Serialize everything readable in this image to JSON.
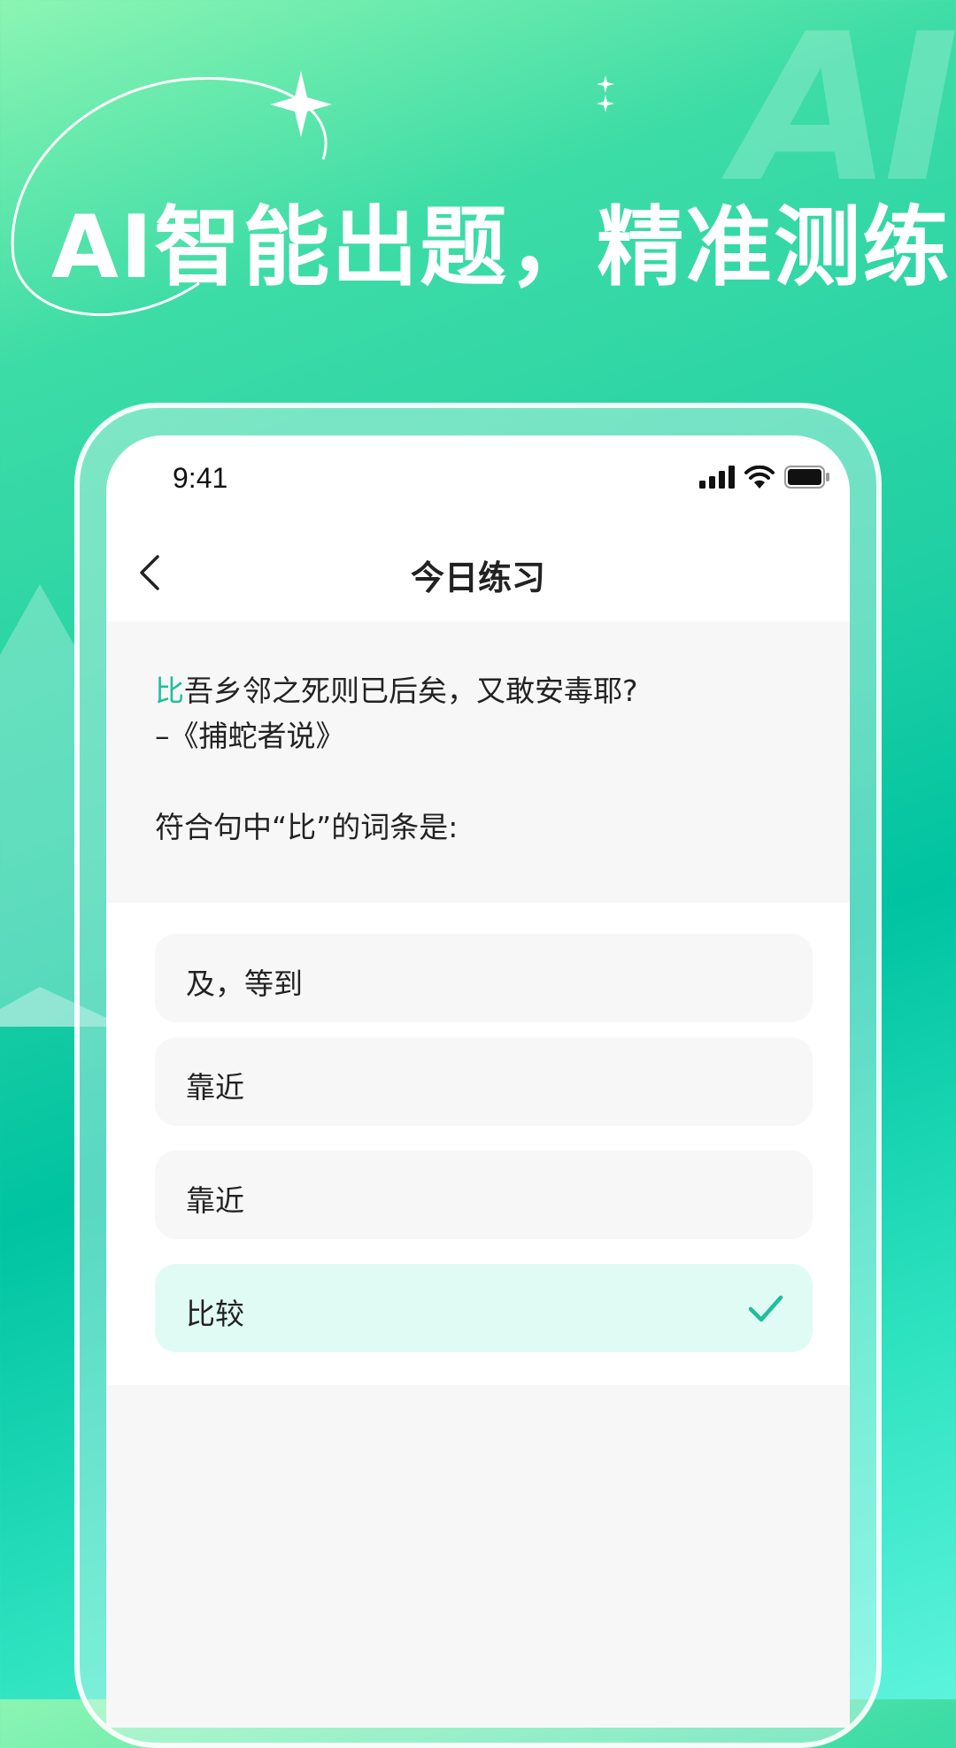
{
  "banner": {
    "headline": "AI智能出题，精准测练",
    "watermark": "AI"
  },
  "status_bar": {
    "time": "9:41"
  },
  "nav": {
    "title": "今日练习"
  },
  "question": {
    "highlight": "比",
    "sentence_rest": "吾乡邻之死则已后矣，又敢安毒耶?",
    "source": "–《捕蛇者说》",
    "prompt": "符合句中“比”的词条是:"
  },
  "options": [
    {
      "label": "及，等到",
      "selected": false
    },
    {
      "label": "靠近",
      "selected": false
    },
    {
      "label": "靠近",
      "selected": false
    },
    {
      "label": "比较",
      "selected": true
    }
  ],
  "colors": {
    "accent": "#1dbf9a",
    "selected_bg": "#e0fbf4",
    "option_bg": "#f7f7f7"
  }
}
